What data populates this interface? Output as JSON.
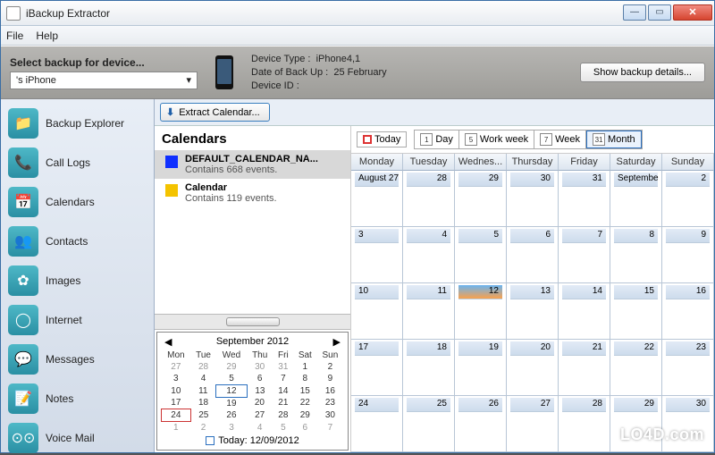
{
  "window": {
    "title": "iBackup Extractor"
  },
  "menu": {
    "file": "File",
    "help": "Help"
  },
  "device": {
    "select_label": "Select backup for device...",
    "selected": "        's iPhone",
    "type_label": "Device Type :",
    "type_value": "iPhone4,1",
    "date_label": "Date of Back Up :",
    "date_value": "25 February",
    "id_label": "Device ID :",
    "id_value": "",
    "details_button": "Show backup details..."
  },
  "sidebar": {
    "items": [
      {
        "label": "Backup Explorer",
        "icon": "📁"
      },
      {
        "label": "Call Logs",
        "icon": "📞"
      },
      {
        "label": "Calendars",
        "icon": "📅"
      },
      {
        "label": "Contacts",
        "icon": "👥"
      },
      {
        "label": "Images",
        "icon": "✿"
      },
      {
        "label": "Internet",
        "icon": "◯"
      },
      {
        "label": "Messages",
        "icon": "💬"
      },
      {
        "label": "Notes",
        "icon": "📝"
      },
      {
        "label": "Voice Mail",
        "icon": "⊙⊙"
      }
    ]
  },
  "toolbar": {
    "extract": "Extract Calendar..."
  },
  "calendars": {
    "heading": "Calendars",
    "list": [
      {
        "name": "DEFAULT_CALENDAR_NA...",
        "sub": "Contains 668 events.",
        "color": "#1030ff"
      },
      {
        "name": "Calendar",
        "sub": "Contains 119 events.",
        "color": "#f4c300"
      }
    ]
  },
  "mini_cal": {
    "month": "September 2012",
    "days": [
      "Mon",
      "Tue",
      "Wed",
      "Thu",
      "Fri",
      "Sat",
      "Sun"
    ],
    "weeks": [
      [
        "27",
        "28",
        "29",
        "30",
        "31",
        "1",
        "2"
      ],
      [
        "3",
        "4",
        "5",
        "6",
        "7",
        "8",
        "9"
      ],
      [
        "10",
        "11",
        "12",
        "13",
        "14",
        "15",
        "16"
      ],
      [
        "17",
        "18",
        "19",
        "20",
        "21",
        "22",
        "23"
      ],
      [
        "24",
        "25",
        "26",
        "27",
        "28",
        "29",
        "30"
      ],
      [
        "1",
        "2",
        "3",
        "4",
        "5",
        "6",
        "7"
      ]
    ],
    "today_label": "Today: 12/09/2012"
  },
  "calendar_view": {
    "today": "Today",
    "segments": {
      "day": "Day",
      "workweek": "Work week",
      "week": "Week",
      "month": "Month"
    },
    "seg_nums": {
      "day": "1",
      "workweek": "5",
      "week": "7",
      "month": "31"
    },
    "headers": [
      "Monday",
      "Tuesday",
      "Wednes...",
      "Thursday",
      "Friday",
      "Saturday",
      "Sunday"
    ],
    "rows": [
      [
        "August 27",
        "28",
        "29",
        "30",
        "31",
        "Septembe",
        "2"
      ],
      [
        "3",
        "4",
        "5",
        "6",
        "7",
        "8",
        "9"
      ],
      [
        "10",
        "11",
        "12",
        "13",
        "14",
        "15",
        "16"
      ],
      [
        "17",
        "18",
        "19",
        "20",
        "21",
        "22",
        "23"
      ],
      [
        "24",
        "25",
        "26",
        "27",
        "28",
        "29",
        "30"
      ]
    ]
  },
  "watermark": "LO4D.com"
}
